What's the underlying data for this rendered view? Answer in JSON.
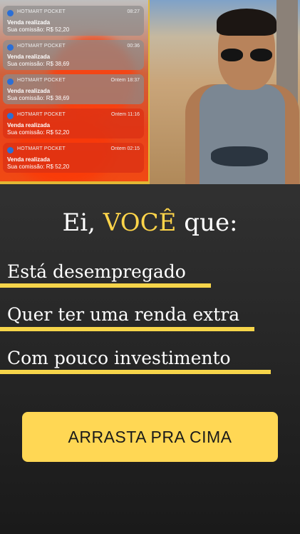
{
  "notifications": [
    {
      "app": "HOTMART POCKET",
      "time": "08:27",
      "title": "Venda realizada",
      "body": "Sua comissão: R$ 52,20"
    },
    {
      "app": "HOTMART POCKET",
      "time": "00:36",
      "title": "Venda realizada",
      "body": "Sua comissão: R$ 38,69"
    },
    {
      "app": "HOTMART POCKET",
      "time": "Ontem 18:37",
      "title": "Venda realizada",
      "body": "Sua comissão: R$ 38,69"
    },
    {
      "app": "HOTMART POCKET",
      "time": "Ontem 11:16",
      "title": "Venda realizada",
      "body": "Sua comissão: R$ 52,20"
    },
    {
      "app": "HOTMART POCKET",
      "time": "Ontem 02:15",
      "title": "Venda realizada",
      "body": "Sua comissão: R$ 52,20"
    }
  ],
  "headline": {
    "prefix": "Ei, ",
    "accent": "VOCÊ",
    "suffix": " que:"
  },
  "items": [
    "Está desempregado",
    "Quer ter uma renda extra",
    "Com pouco investimento"
  ],
  "cta": {
    "label": "ARRASTA PRA CIMA"
  },
  "colors": {
    "accent": "#ffd54a",
    "button": "#ffd754",
    "underline": "#f6d54a"
  }
}
